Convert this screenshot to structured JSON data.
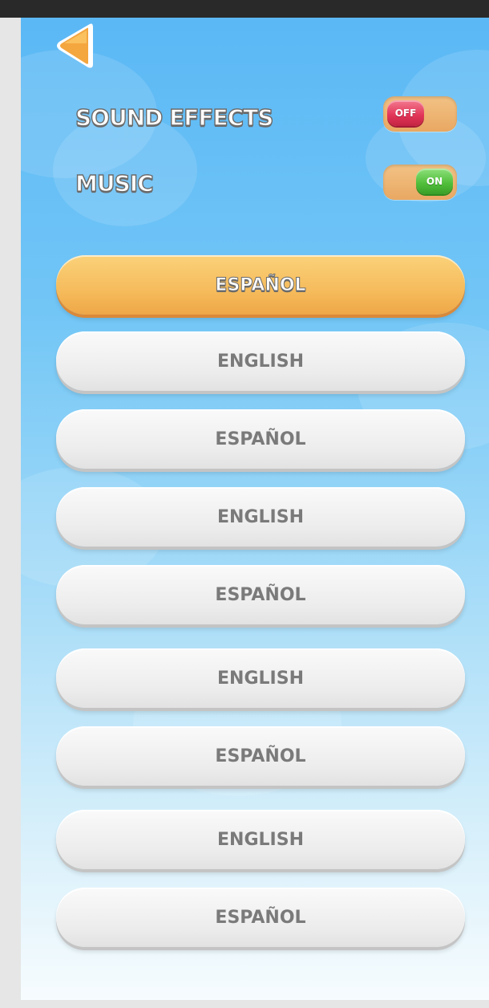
{
  "settings": {
    "sound_effects": {
      "label": "SOUND EFFECTS",
      "state": "OFF"
    },
    "music": {
      "label": "MUSIC",
      "state": "ON"
    }
  },
  "back": {
    "icon": "back-arrow-icon"
  },
  "languages": [
    {
      "label": "ESPAÑOL",
      "selected": true
    },
    {
      "label": "ENGLISH",
      "selected": false
    },
    {
      "label": "ESPAÑOL",
      "selected": false
    },
    {
      "label": "ENGLISH",
      "selected": false
    },
    {
      "label": "ESPAÑOL",
      "selected": false
    },
    {
      "label": "ENGLISH",
      "selected": false
    },
    {
      "label": "ESPAÑOL",
      "selected": false
    },
    {
      "label": "ENGLISH",
      "selected": false
    },
    {
      "label": "ESPAÑOL",
      "selected": false
    }
  ],
  "colors": {
    "sky_top": "#5bb8f5",
    "selected_button": "#f5b959",
    "off_toggle": "#e03457",
    "on_toggle": "#4fbd3a"
  }
}
